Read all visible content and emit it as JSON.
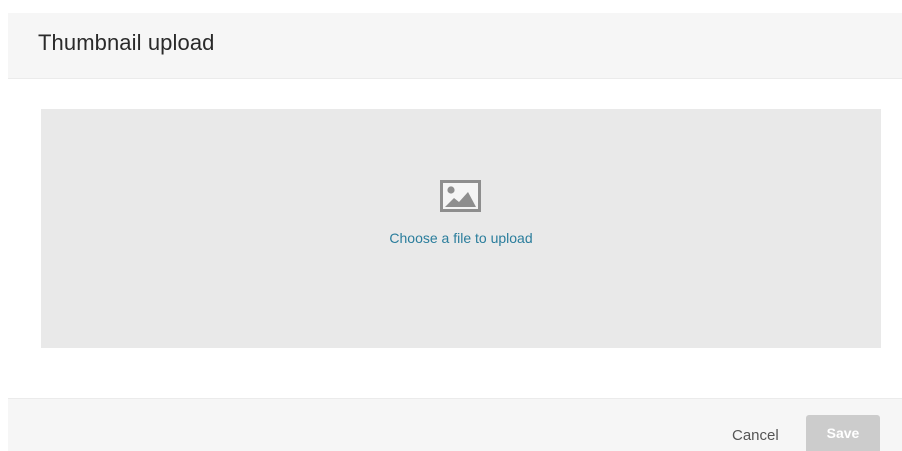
{
  "dialog": {
    "title": "Thumbnail upload"
  },
  "dropzone": {
    "icon": "image-icon",
    "link_text": "Choose a file to upload"
  },
  "footer": {
    "cancel_label": "Cancel",
    "save_label": "Save"
  },
  "colors": {
    "link": "#2a7d9c",
    "dropzone_bg": "#e9e9e9",
    "panel_bg": "#f6f6f6",
    "save_disabled": "#cccccc"
  }
}
